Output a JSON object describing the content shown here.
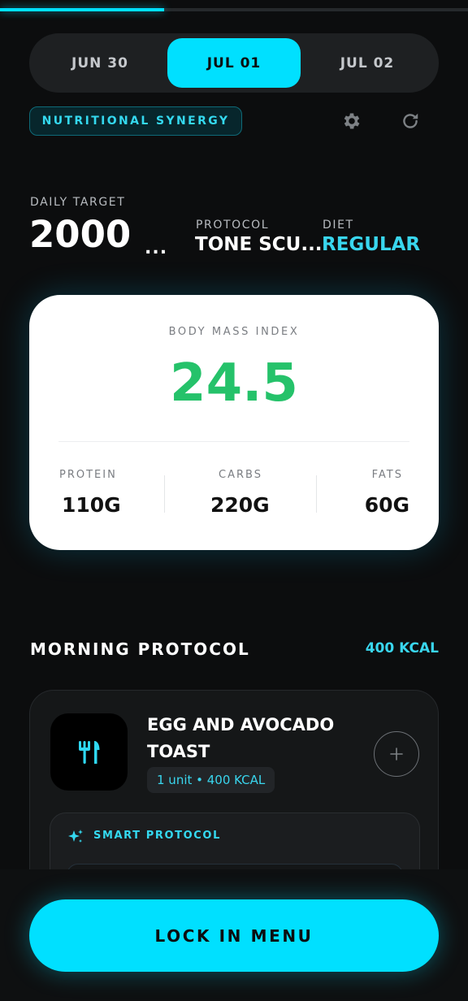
{
  "progress": {
    "fraction": 0.35,
    "color": "#00e0ff"
  },
  "date_tabs": [
    {
      "label": "JUN 30",
      "selected": false
    },
    {
      "label": "JUL 01",
      "selected": true
    },
    {
      "label": "JUL 02",
      "selected": false
    }
  ],
  "badge": {
    "label": "NUTRITIONAL SYNERGY"
  },
  "toolbar": {
    "settings_icon": "gear-icon",
    "refresh_icon": "refresh-icon"
  },
  "targets": {
    "daily_label": "DAILY TARGET",
    "daily_value": "2000",
    "daily_truncation": "...",
    "protocol_label": "PROTOCOL",
    "protocol_value": "TONE SCU...",
    "diet_label": "DIET",
    "diet_value": "REGULAR"
  },
  "bmi_card": {
    "label": "BODY MASS INDEX",
    "value": "24.5",
    "value_color": "#25c26a",
    "macros": [
      {
        "label": "PROTEIN",
        "value": "110G"
      },
      {
        "label": "CARBS",
        "value": "220G"
      },
      {
        "label": "FATS",
        "value": "60G"
      }
    ]
  },
  "morning": {
    "title": "MORNING PROTOCOL",
    "kcal": "400 KCAL",
    "meal": {
      "icon": "utensils-icon",
      "title": "EGG AND AVOCADO TOAST",
      "meta": "1 unit • 400 KCAL",
      "add_icon": "plus-icon",
      "smart_label": "SMART PROTOCOL",
      "smart_icon": "sparkle-icon"
    }
  },
  "footer": {
    "cta_label": "LOCK IN MENU"
  },
  "colors": {
    "accent": "#00e0ff",
    "bmi_green": "#25c26a",
    "background": "#0c0d0e"
  }
}
